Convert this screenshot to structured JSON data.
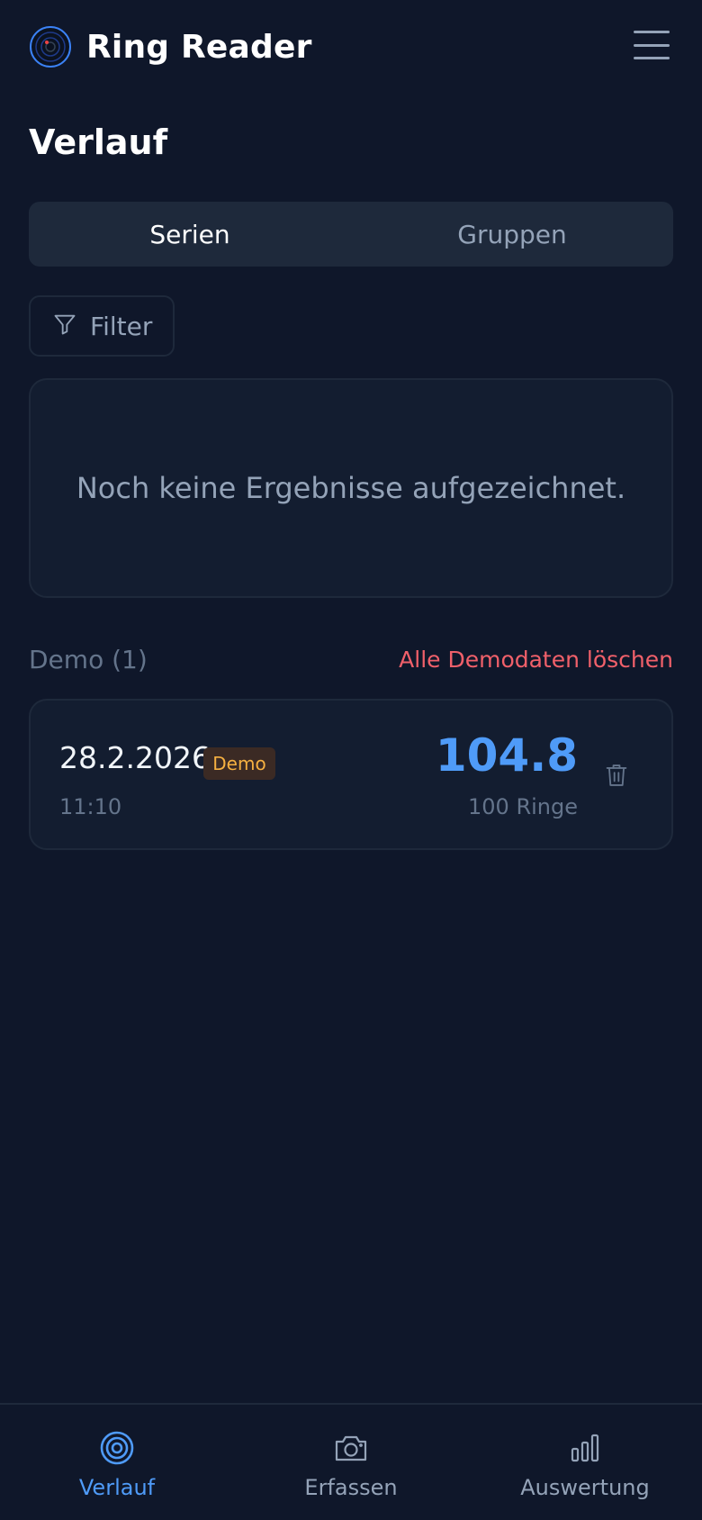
{
  "header": {
    "app_title": "Ring Reader",
    "logo_icon": "target-logo-icon",
    "menu_icon": "hamburger-menu-icon"
  },
  "page": {
    "title": "Verlauf"
  },
  "tabs": [
    {
      "label": "Serien",
      "active": true
    },
    {
      "label": "Gruppen",
      "active": false
    }
  ],
  "filter": {
    "label": "Filter",
    "icon": "funnel-icon"
  },
  "empty_state": {
    "text": "Noch keine Ergebnisse aufgezeichnet."
  },
  "demo": {
    "label": "Demo (1)",
    "clear_label": "Alle Demodaten löschen",
    "items": [
      {
        "date": "28.2.2026",
        "badge": "Demo",
        "time": "11:10",
        "score": "104.8",
        "rings": "100 Ringe",
        "delete_icon": "trash-icon"
      }
    ]
  },
  "bottom_nav": [
    {
      "label": "Verlauf",
      "icon": "target-icon",
      "active": true
    },
    {
      "label": "Erfassen",
      "icon": "camera-icon",
      "active": false
    },
    {
      "label": "Auswertung",
      "icon": "bar-chart-icon",
      "active": false
    }
  ],
  "colors": {
    "background": "#0f172a",
    "surface": "#1e293b",
    "accent": "#4f9bf8",
    "danger": "#f0606a",
    "badge_text": "#f5b041"
  }
}
